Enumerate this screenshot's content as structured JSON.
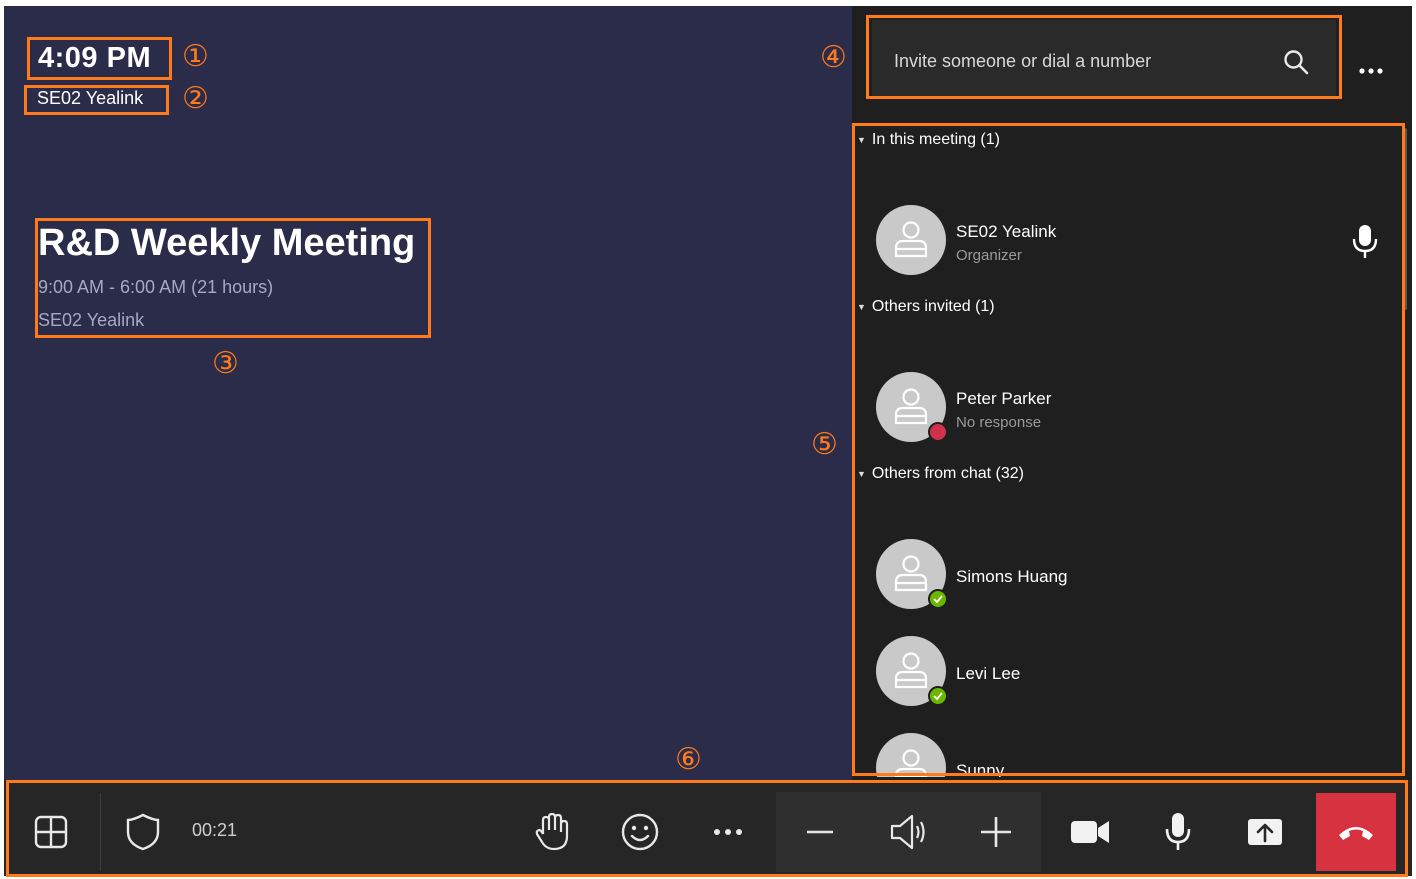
{
  "clock": "4:09 PM",
  "room_name": "SE02 Yealink",
  "meeting": {
    "title": "R&D Weekly Meeting",
    "time": "9:00 AM - 6:00 AM (21 hours)",
    "organizer": "SE02 Yealink"
  },
  "markers": [
    "①",
    "②",
    "③",
    "④",
    "⑤",
    "⑥"
  ],
  "search": {
    "placeholder": "Invite someone or dial a number",
    "icon": "search-icon"
  },
  "participants": {
    "sections": [
      {
        "header": "In this meeting (1)",
        "people": [
          {
            "name": "SE02 Yealink",
            "role": "Organizer",
            "status": "none",
            "mic": true
          }
        ]
      },
      {
        "header": "Others invited (1)",
        "people": [
          {
            "name": "Peter Parker",
            "role": "No response",
            "status": "busy"
          }
        ]
      },
      {
        "header": "Others from chat (32)",
        "people": [
          {
            "name": "Simons Huang",
            "role": "",
            "status": "available"
          },
          {
            "name": "Levi Lee",
            "role": "",
            "status": "available"
          },
          {
            "name": "Sunny",
            "role": "",
            "status": "none"
          }
        ]
      }
    ]
  },
  "call_bar": {
    "timer": "00:21",
    "icons": [
      "layout-icon",
      "shield-icon",
      "raise-hand-icon",
      "reaction-icon",
      "more-icon",
      "volume-down-icon",
      "speaker-icon",
      "volume-up-icon",
      "camera-icon",
      "microphone-icon",
      "share-icon",
      "hang-up-icon"
    ]
  },
  "colors": {
    "main_bg": "#2b2b4a",
    "panel_bg": "#1f1f1f",
    "annotation": "#ff7a1a",
    "hangup": "#d7323f",
    "busy": "#d1304a",
    "available": "#6bb700"
  }
}
